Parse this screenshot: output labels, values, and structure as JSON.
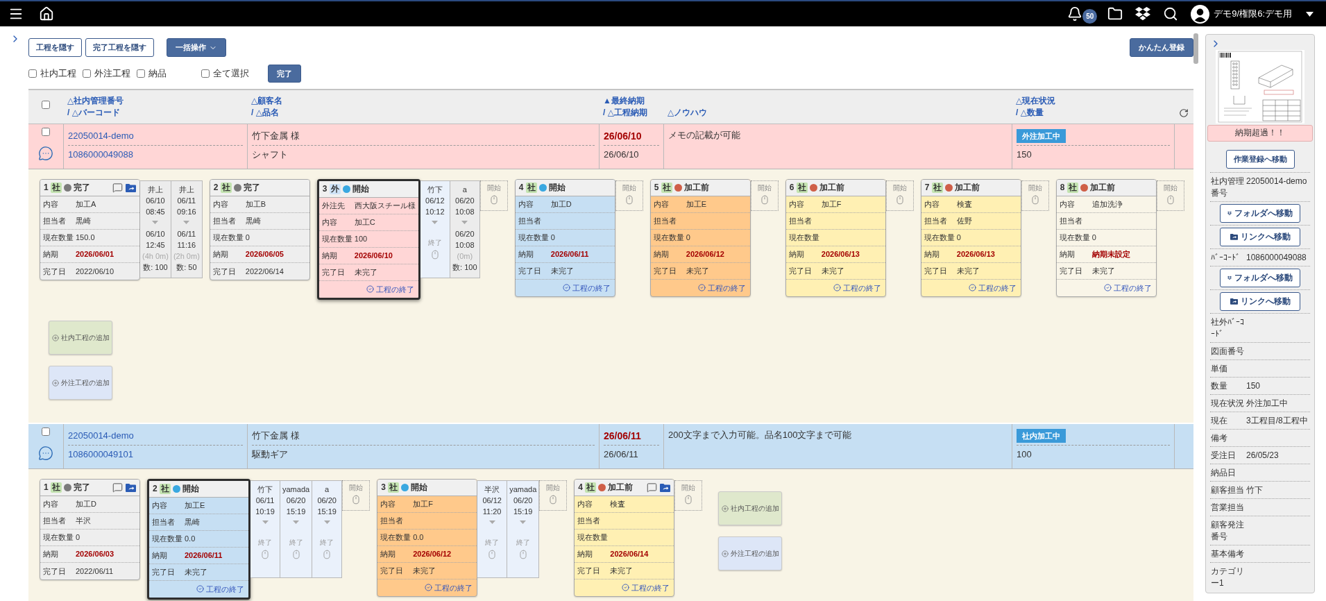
{
  "header": {
    "notifications": "50",
    "user": "デモ9/権限6:デモ用"
  },
  "toolbar": {
    "buttons": [
      "工程を隠す",
      "完了工程を隠す"
    ],
    "bulk": "一括操作",
    "quick_register": "かんたん登録"
  },
  "filters": [
    {
      "label": "社内工程",
      "checked": false
    },
    {
      "label": "外注工程",
      "checked": false
    },
    {
      "label": "納品",
      "checked": false
    }
  ],
  "select_all": {
    "label": "全て選択",
    "checked": false
  },
  "complete_button": "完了",
  "table": {
    "checked": false,
    "columns": [
      {
        "lines": [
          "△社内管理番号",
          "/ △バーコード"
        ]
      },
      {
        "lines": [
          "△顧客名",
          "/ △品名"
        ]
      },
      {
        "lines": [
          "▲最終納期",
          "/ △工程納期"
        ]
      },
      {
        "lines": [
          "△ノウハウ"
        ]
      },
      {
        "lines": [
          "△現在状況",
          "/ △数量"
        ]
      }
    ]
  },
  "orders": [
    {
      "checked": false,
      "color": "#ffd6d6",
      "management_no": "22050014-demo",
      "barcode": "1086000049088",
      "customer": "竹下金属 様",
      "product": "シャフト",
      "final_due": "26/06/10",
      "process_due": "26/06/10",
      "memo": "メモの記載が可能",
      "status": "外注加工中",
      "quantity": "150",
      "processes": [
        {
          "no": "1",
          "tag": "社",
          "kind": "internal",
          "status": {
            "label": "完了",
            "color": "#7b7b7b"
          },
          "selected": false,
          "icons": true,
          "color": "#eeeeee",
          "fields": [
            {
              "label": "内容",
              "value": "加工A",
              "kind": "text"
            },
            {
              "label": "担当者",
              "value": "黒崎",
              "kind": "text"
            },
            {
              "label": "現在数量",
              "value": "150.0",
              "kind": "text"
            },
            {
              "label": "納期",
              "value": "2026/06/01",
              "kind": "due"
            },
            {
              "label": "完了日",
              "value": "2022/06/10",
              "kind": "text"
            }
          ],
          "logs": [
            {
              "kind": "done",
              "user": "井上",
              "start_date": "06/10",
              "start_time": "08:45",
              "end_date": "06/10",
              "end_time": "12:45",
              "duration": "(4h 0m)",
              "qty": "数: 100"
            },
            {
              "kind": "done",
              "user": "井上",
              "start_date": "06/11",
              "start_time": "09:16",
              "end_date": "06/11",
              "end_time": "11:16",
              "duration": "(2h 0m)",
              "qty": "数: 50"
            }
          ]
        },
        {
          "no": "2",
          "tag": "社",
          "kind": "internal",
          "status": {
            "label": "完了",
            "color": "#7b7b7b"
          },
          "selected": false,
          "icons": false,
          "color": "#eeeeee",
          "fields": [
            {
              "label": "内容",
              "value": "加工B",
              "kind": "text"
            },
            {
              "label": "担当者",
              "value": "黒崎",
              "kind": "text"
            },
            {
              "label": "現在数量",
              "value": "0",
              "kind": "text"
            },
            {
              "label": "納期",
              "value": "2026/06/05",
              "kind": "due"
            },
            {
              "label": "完了日",
              "value": "2022/06/14",
              "kind": "text"
            }
          ]
        },
        {
          "no": "3",
          "tag": "外",
          "kind": "external",
          "status": {
            "label": "開始",
            "color": "#3aa8e0"
          },
          "selected": true,
          "icons": false,
          "color": "#ffd6d6",
          "fields": [
            {
              "label": "外注先",
              "value": "西大阪スチール様",
              "kind": "text"
            },
            {
              "label": "内容",
              "value": "加工C",
              "kind": "text"
            },
            {
              "label": "現在数量",
              "value": "100",
              "kind": "text"
            },
            {
              "label": "納期",
              "value": "2026/06/10",
              "kind": "due"
            },
            {
              "label": "完了日",
              "value": "未完了",
              "kind": "text"
            }
          ],
          "finish": "工程の終了",
          "logs": [
            {
              "kind": "running",
              "user": "竹下",
              "start_date": "06/12",
              "start_time": "10:12",
              "end_label": "終了"
            },
            {
              "kind": "done",
              "user": "a",
              "start_date": "06/20",
              "start_time": "10:08",
              "end_date": "06/20",
              "end_time": "10:08",
              "duration": "(0m)",
              "qty": "数: 100"
            }
          ],
          "start": "開始"
        },
        {
          "no": "4",
          "tag": "社",
          "kind": "internal",
          "status": {
            "label": "開始",
            "color": "#3aa8e0"
          },
          "selected": false,
          "icons": false,
          "color": "#c6dff3",
          "fields": [
            {
              "label": "内容",
              "value": "加工D",
              "kind": "text"
            },
            {
              "label": "担当者"
            },
            {
              "label": "現在数量",
              "value": "0",
              "kind": "text"
            },
            {
              "label": "納期",
              "value": "2026/06/11",
              "kind": "due"
            },
            {
              "label": "完了日",
              "value": "未完了",
              "kind": "text"
            }
          ],
          "finish": "工程の終了",
          "start": "開始"
        },
        {
          "no": "5",
          "tag": "社",
          "kind": "internal",
          "status": {
            "label": "加工前",
            "color": "#cf5f48"
          },
          "selected": false,
          "icons": false,
          "color": "#ffc98b",
          "fields": [
            {
              "label": "内容",
              "value": "加工E",
              "kind": "text"
            },
            {
              "label": "担当者"
            },
            {
              "label": "現在数量",
              "value": "0",
              "kind": "text"
            },
            {
              "label": "納期",
              "value": "2026/06/12",
              "kind": "due"
            },
            {
              "label": "完了日",
              "value": "未完了",
              "kind": "text"
            }
          ],
          "finish": "工程の終了",
          "start": "開始"
        },
        {
          "no": "6",
          "tag": "社",
          "kind": "internal",
          "status": {
            "label": "加工前",
            "color": "#cf5f48"
          },
          "selected": false,
          "icons": false,
          "color": "#fff0b3",
          "fields": [
            {
              "label": "内容",
              "value": "加工F",
              "kind": "text"
            },
            {
              "label": "担当者"
            },
            {
              "label": "現在数量"
            },
            {
              "label": "納期",
              "value": "2026/06/13",
              "kind": "due"
            },
            {
              "label": "完了日",
              "value": "未完了",
              "kind": "text"
            }
          ],
          "finish": "工程の終了",
          "start": "開始"
        },
        {
          "no": "7",
          "tag": "社",
          "kind": "internal",
          "status": {
            "label": "加工前",
            "color": "#cf5f48"
          },
          "selected": false,
          "icons": false,
          "color": "#fff0b3",
          "fields": [
            {
              "label": "内容",
              "value": "検査",
              "kind": "text"
            },
            {
              "label": "担当者",
              "value": "佐野",
              "kind": "text"
            },
            {
              "label": "現在数量",
              "value": "0",
              "kind": "text"
            },
            {
              "label": "納期",
              "value": "2026/06/13",
              "kind": "due"
            },
            {
              "label": "完了日",
              "value": "未完了",
              "kind": "text"
            }
          ],
          "finish": "工程の終了",
          "start": "開始"
        },
        {
          "no": "8",
          "tag": "社",
          "kind": "internal",
          "status": {
            "label": "加工前",
            "color": "#cf5f48"
          },
          "selected": false,
          "icons": false,
          "color": "#f9f5e8",
          "fields": [
            {
              "label": "内容",
              "value": "追加洗浄",
              "kind": "text"
            },
            {
              "label": "担当者"
            },
            {
              "label": "現在数量",
              "value": "0",
              "kind": "text"
            },
            {
              "label": "納期",
              "value": "納期未設定",
              "kind": "due"
            },
            {
              "label": "完了日",
              "value": "未完了",
              "kind": "text"
            }
          ],
          "finish": "工程の終了",
          "start": "開始"
        }
      ],
      "add_buttons": [
        {
          "label": "社内工程の追加",
          "kind": "internal"
        },
        {
          "label": "外注工程の追加",
          "kind": "external"
        }
      ]
    },
    {
      "checked": false,
      "color": "#c6dff3",
      "management_no": "22050014-demo",
      "barcode": "1086000049101",
      "customer": "竹下金属 様",
      "product": "駆動ギア",
      "final_due": "26/06/11",
      "process_due": "26/06/11",
      "memo": "200文字まで入力可能。品名100文字まで可能",
      "status": "社内加工中",
      "quantity": "100",
      "processes": [
        {
          "no": "1",
          "tag": "社",
          "kind": "internal",
          "status": {
            "label": "完了",
            "color": "#7b7b7b"
          },
          "selected": false,
          "icons": true,
          "color": "#eeeeee",
          "fields": [
            {
              "label": "内容",
              "value": "加工D",
              "kind": "text"
            },
            {
              "label": "担当者",
              "value": "半沢",
              "kind": "text"
            },
            {
              "label": "現在数量",
              "value": "0",
              "kind": "text"
            },
            {
              "label": "納期",
              "value": "2026/06/03",
              "kind": "due"
            },
            {
              "label": "完了日",
              "value": "2022/06/11",
              "kind": "text"
            }
          ]
        },
        {
          "no": "2",
          "tag": "社",
          "kind": "internal",
          "status": {
            "label": "開始",
            "color": "#3aa8e0"
          },
          "selected": true,
          "icons": false,
          "color": "#c6dff3",
          "fields": [
            {
              "label": "内容",
              "value": "加工E",
              "kind": "text"
            },
            {
              "label": "担当者",
              "value": "黒崎",
              "kind": "text"
            },
            {
              "label": "現在数量",
              "value": "0.0",
              "kind": "text"
            },
            {
              "label": "納期",
              "value": "2026/06/11",
              "kind": "due"
            },
            {
              "label": "完了日",
              "value": "未完了",
              "kind": "text"
            }
          ],
          "finish": "工程の終了",
          "logs": [
            {
              "kind": "running",
              "user": "竹下",
              "start_date": "06/11",
              "start_time": "10:19",
              "end_label": "終了"
            },
            {
              "kind": "running",
              "user": "yamada",
              "start_date": "06/20",
              "start_time": "15:19",
              "end_label": "終了"
            },
            {
              "kind": "running",
              "user": "a",
              "start_date": "06/20",
              "start_time": "15:19",
              "end_label": "終了"
            }
          ],
          "start": "開始"
        },
        {
          "no": "3",
          "tag": "社",
          "kind": "internal",
          "status": {
            "label": "開始",
            "color": "#3aa8e0"
          },
          "selected": false,
          "icons": false,
          "color": "#ffc98b",
          "fields": [
            {
              "label": "内容",
              "value": "加工F",
              "kind": "text"
            },
            {
              "label": "担当者"
            },
            {
              "label": "現在数量",
              "value": "0.0",
              "kind": "text"
            },
            {
              "label": "納期",
              "value": "2026/06/12",
              "kind": "due"
            },
            {
              "label": "完了日",
              "value": "未完了",
              "kind": "text"
            }
          ],
          "finish": "工程の終了",
          "logs": [
            {
              "kind": "running",
              "user": "半沢",
              "start_date": "06/12",
              "start_time": "11:20",
              "end_label": "終了"
            },
            {
              "kind": "running",
              "user": "yamada",
              "start_date": "06/20",
              "start_time": "15:19",
              "end_label": "終了"
            }
          ],
          "start": "開始"
        },
        {
          "no": "4",
          "tag": "社",
          "kind": "internal",
          "status": {
            "label": "加工前",
            "color": "#cf5f48"
          },
          "selected": false,
          "icons": true,
          "color": "#fff0b3",
          "fields": [
            {
              "label": "内容",
              "value": "検査",
              "kind": "text"
            },
            {
              "label": "担当者"
            },
            {
              "label": "現在数量"
            },
            {
              "label": "納期",
              "value": "2026/06/14",
              "kind": "due"
            },
            {
              "label": "完了日",
              "value": "未完了",
              "kind": "text"
            }
          ],
          "finish": "工程の終了",
          "start": "開始"
        }
      ],
      "add_buttons": [
        {
          "label": "社内工程の追加",
          "kind": "internal"
        },
        {
          "label": "外注工程の追加",
          "kind": "external"
        }
      ]
    }
  ],
  "detail": {
    "alert": "納期超過！！",
    "work_button": "作業登録へ移動",
    "rows": [
      {
        "kind": "field",
        "label": "社内管理番号",
        "value": "22050014-demo"
      },
      {
        "kind": "folder",
        "label": "フォルダへ移動"
      },
      {
        "kind": "link",
        "label": "リンクへ移動"
      },
      {
        "kind": "field",
        "label": "ﾊﾞｰｺｰﾄﾞ",
        "value": "1086000049088"
      },
      {
        "kind": "folder",
        "label": "フォルダへ移動"
      },
      {
        "kind": "link",
        "label": "リンクへ移動"
      },
      {
        "kind": "field",
        "label": "社外ﾊﾞｰｺｰﾄﾞ"
      },
      {
        "kind": "field",
        "label": "図面番号"
      },
      {
        "kind": "field",
        "label": "単価"
      },
      {
        "kind": "field",
        "label": "数量",
        "value": "150"
      },
      {
        "kind": "field",
        "label": "現在状況",
        "value": "外注加工中"
      },
      {
        "kind": "field",
        "label": "現在",
        "value": "3工程目/8工程中"
      },
      {
        "kind": "field",
        "label": "備考"
      },
      {
        "kind": "field",
        "label": "受注日",
        "value": "26/05/23"
      },
      {
        "kind": "field",
        "label": "納品日"
      },
      {
        "kind": "field",
        "label": "顧客担当",
        "value": "竹下"
      },
      {
        "kind": "field",
        "label": "営業担当"
      },
      {
        "kind": "field",
        "label": "顧客発注番号"
      },
      {
        "kind": "field",
        "label": "基本備考"
      },
      {
        "kind": "field",
        "label": "カテゴリー1"
      }
    ]
  }
}
